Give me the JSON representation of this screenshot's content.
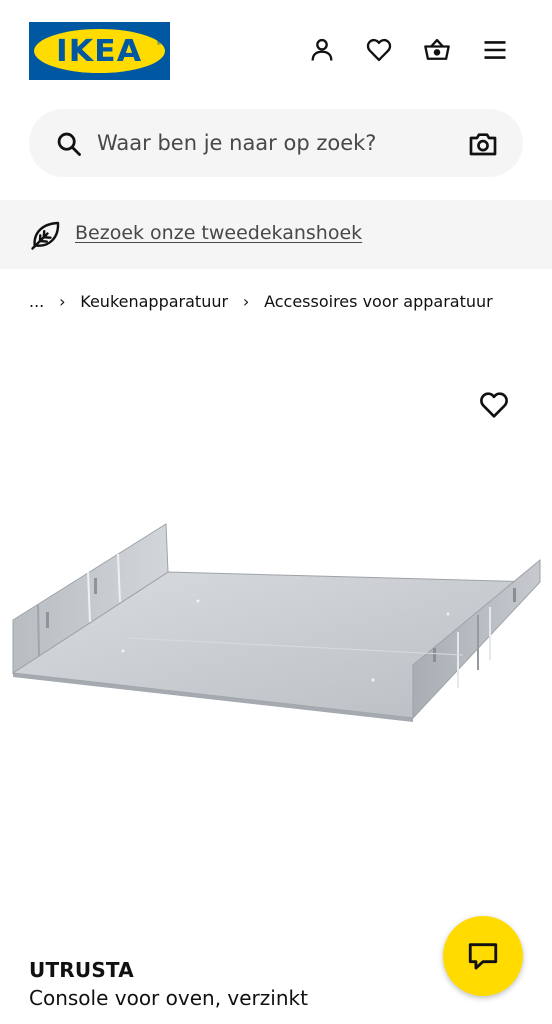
{
  "header": {
    "logo_text": "IKEA",
    "logo_mark": "®",
    "icons": [
      "user-icon",
      "heart-icon",
      "basket-icon",
      "menu-icon"
    ]
  },
  "search": {
    "placeholder": "Waar ben je naar op zoek?",
    "icon": "search-icon",
    "camera_icon": "camera-icon"
  },
  "banner": {
    "icon": "leaf-icon",
    "link_text": "Bezoek onze tweedekanshoek"
  },
  "breadcrumb": {
    "items": [
      "...",
      "Keukenapparatuur",
      "Accessoires voor apparatuur"
    ],
    "separator": "›"
  },
  "product": {
    "name": "UTRUSTA",
    "description": "Console voor oven, verzinkt",
    "favorite_icon": "heart-icon"
  },
  "chat": {
    "icon": "chat-icon"
  },
  "colors": {
    "brand_blue": "#0058a3",
    "brand_yellow": "#ffdb00",
    "surface_grey": "#f5f5f5",
    "text": "#111111"
  }
}
